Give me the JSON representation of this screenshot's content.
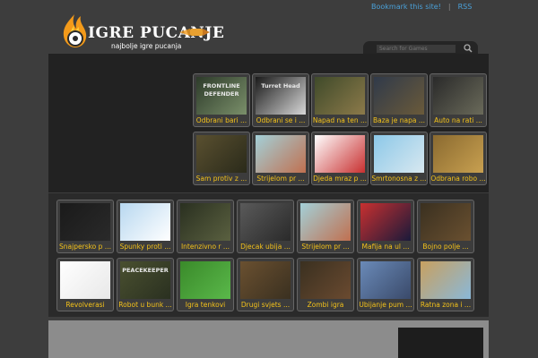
{
  "top_links": {
    "bookmark": "Bookmark this site!",
    "separator": "|",
    "rss": "RSS"
  },
  "logo": {
    "title": "IGRE PUCANJE",
    "subtitle": "najbolje igre pucanja"
  },
  "search": {
    "placeholder": "Search for Games"
  },
  "featured_games": [
    {
      "label": "Odbrani bari ...",
      "thumb_text": "FRONTLINE DEFENDER",
      "colors": [
        "#2d3b2a",
        "#7a8f6a"
      ]
    },
    {
      "label": "Odbrani se i ...",
      "thumb_text": "Turret Head",
      "colors": [
        "#1a1a1a",
        "#d8d8d8"
      ]
    },
    {
      "label": "Napad na ten ...",
      "thumb_text": "",
      "colors": [
        "#3f4a2a",
        "#8c7a4a"
      ]
    },
    {
      "label": "Baza je napa ...",
      "thumb_text": "",
      "colors": [
        "#303a4a",
        "#6a5a3a"
      ]
    },
    {
      "label": "Auto na rati ...",
      "thumb_text": "",
      "colors": [
        "#2a2a2a",
        "#6a6a5a"
      ]
    },
    {
      "label": "Sam protiv z ...",
      "thumb_text": "",
      "colors": [
        "#5a5030",
        "#2a2a1a"
      ]
    },
    {
      "label": "Strijelom pr ...",
      "thumb_text": "",
      "colors": [
        "#a3d0d8",
        "#c07050"
      ]
    },
    {
      "label": "Djeda mraz p ...",
      "thumb_text": "",
      "colors": [
        "#ffffff",
        "#c83030"
      ]
    },
    {
      "label": "Smrtonosna z ...",
      "thumb_text": "",
      "colors": [
        "#8cc8e8",
        "#d8e8f0"
      ]
    },
    {
      "label": "Odbrana robo ...",
      "thumb_text": "",
      "colors": [
        "#8a6a30",
        "#c8a050"
      ]
    }
  ],
  "more_games": [
    {
      "label": "Snajpersko p ...",
      "thumb_text": "",
      "colors": [
        "#1a1a1a",
        "#2a2a2a"
      ]
    },
    {
      "label": "Spunky proti ...",
      "thumb_text": "",
      "colors": [
        "#b8d8f0",
        "#ffffff"
      ]
    },
    {
      "label": "Intenzivno r ...",
      "thumb_text": "",
      "colors": [
        "#2a3020",
        "#5a6040"
      ]
    },
    {
      "label": "Djecak ubija ...",
      "thumb_text": "",
      "colors": [
        "#5a5a5a",
        "#2a2a2a"
      ]
    },
    {
      "label": "Strijelom pr ...",
      "thumb_text": "",
      "colors": [
        "#a3d0d8",
        "#c07050"
      ]
    },
    {
      "label": "Mafija na ul ...",
      "thumb_text": "",
      "colors": [
        "#c83030",
        "#1a1a3a"
      ]
    },
    {
      "label": "Bojno polje ...",
      "thumb_text": "",
      "colors": [
        "#3a3020",
        "#6a5030"
      ]
    },
    {
      "label": "Revolverasi",
      "thumb_text": "",
      "colors": [
        "#ffffff",
        "#e8e8e8"
      ]
    },
    {
      "label": "Robot u bunk ...",
      "thumb_text": "PEACEKEEPER",
      "colors": [
        "#4a5030",
        "#2a3020"
      ]
    },
    {
      "label": "Igra tenkovi",
      "thumb_text": "",
      "colors": [
        "#3a8a2a",
        "#5ab84a"
      ]
    },
    {
      "label": "Drugi svjets ...",
      "thumb_text": "",
      "colors": [
        "#6a5030",
        "#3a3020"
      ]
    },
    {
      "label": "Zombi igra",
      "thumb_text": "",
      "colors": [
        "#3a3020",
        "#6a4a30"
      ]
    },
    {
      "label": "Ubijanje pum ...",
      "thumb_text": "",
      "colors": [
        "#6a8ab8",
        "#3a4a6a"
      ]
    },
    {
      "label": "Ratna zona i ...",
      "thumb_text": "",
      "colors": [
        "#c8a060",
        "#8ab8d8"
      ]
    }
  ]
}
